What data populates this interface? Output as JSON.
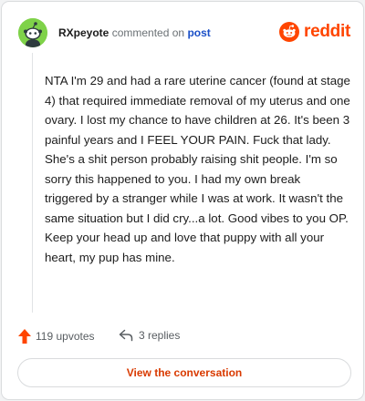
{
  "header": {
    "username": "RXpeyote",
    "action_text": "commented on",
    "post_link": "post",
    "brand": "reddit",
    "avatar_icon": "snoo-avatar-icon",
    "brand_icon": "reddit-logo-icon"
  },
  "comment": {
    "text": "NTA I'm 29 and had a rare uterine cancer (found at stage 4) that required immediate removal of my uterus and one ovary. I lost my chance to have children at 26. It's been 3 painful years and I FEEL YOUR PAIN. Fuck that lady. She's a shit person probably raising shit people. I'm so sorry this happened to you. I had my own break triggered by a stranger while I was at work. It wasn't the same situation but I did cry...a lot. Good vibes to you OP. Keep your head up and love that puppy with all your heart, my pup has mine."
  },
  "footer": {
    "upvotes_label": "119 upvotes",
    "replies_label": "3 replies",
    "upvote_icon": "upvote-arrow-icon",
    "reply_icon": "reply-arrow-icon"
  },
  "cta": {
    "label": "View the conversation"
  },
  "colors": {
    "brand": "#ff4500",
    "link": "#1a4fc7",
    "avatar_bg": "#7fd249",
    "cta_text": "#d93a00"
  }
}
